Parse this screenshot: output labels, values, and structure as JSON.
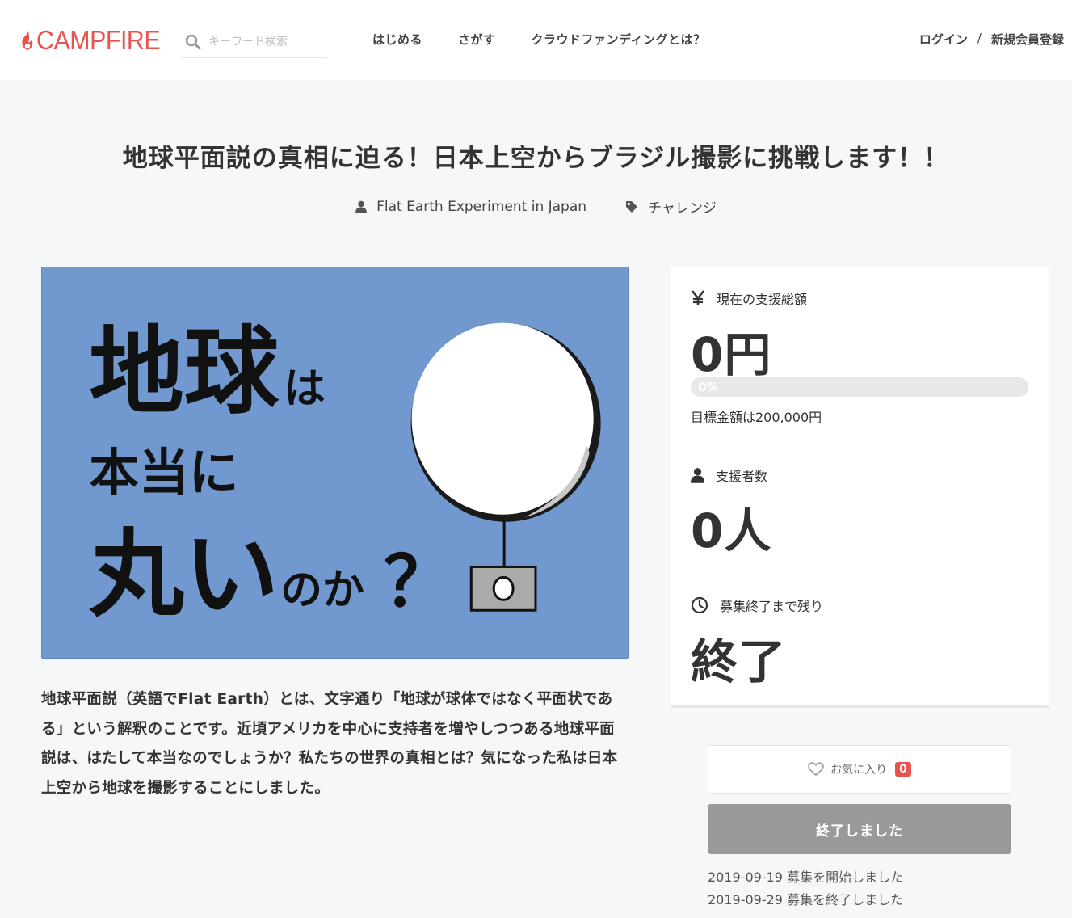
{
  "header": {
    "logo_text": "CAMPFIRE",
    "search_placeholder": "キーワード検索",
    "nav": [
      "はじめる",
      "さがす",
      "クラウドファンディングとは？"
    ],
    "login": "ログイン",
    "separator": "/",
    "signup": "新規会員登録"
  },
  "project": {
    "title": "地球平面説の真相に迫る！日本上空からブラジル撮影に挑戦します！！",
    "owner": "Flat Earth Experiment in Japan",
    "category": "チャレンジ",
    "hero": {
      "line1_big": "地球",
      "line1_small": "は",
      "line2": "本当に",
      "line3_big": "丸い",
      "line3_small": "のか",
      "question": "？"
    },
    "description": "地球平面説（英語でFlat Earth）とは、文字通り「地球が球体ではなく平面状である」という解釈のことです。近頃アメリカを中心に支持者を増やしつつある地球平面説は、はたして本当なのでしょうか？私たちの世界の真相とは？気になった私は日本上空から地球を撮影することにしました。"
  },
  "stats": {
    "funding_label": "現在の支援総額",
    "funding_value": "0円",
    "progress_percent": 0,
    "progress_text": "0%",
    "goal_text": "目標金額は200,000円",
    "backers_label": "支援者数",
    "backers_value": "0人",
    "remaining_label": "募集終了まで残り",
    "remaining_value": "終了"
  },
  "actions": {
    "favorite_label": "お気に入り",
    "favorite_count": "0",
    "ended_label": "終了しました"
  },
  "dates": {
    "start": "2019-09-19 募集を開始しました",
    "end": "2019-09-29 募集を終了しました"
  },
  "colors": {
    "brand": "#e8534f",
    "hero_bg": "#7199d0",
    "ended_button": "#999999"
  }
}
